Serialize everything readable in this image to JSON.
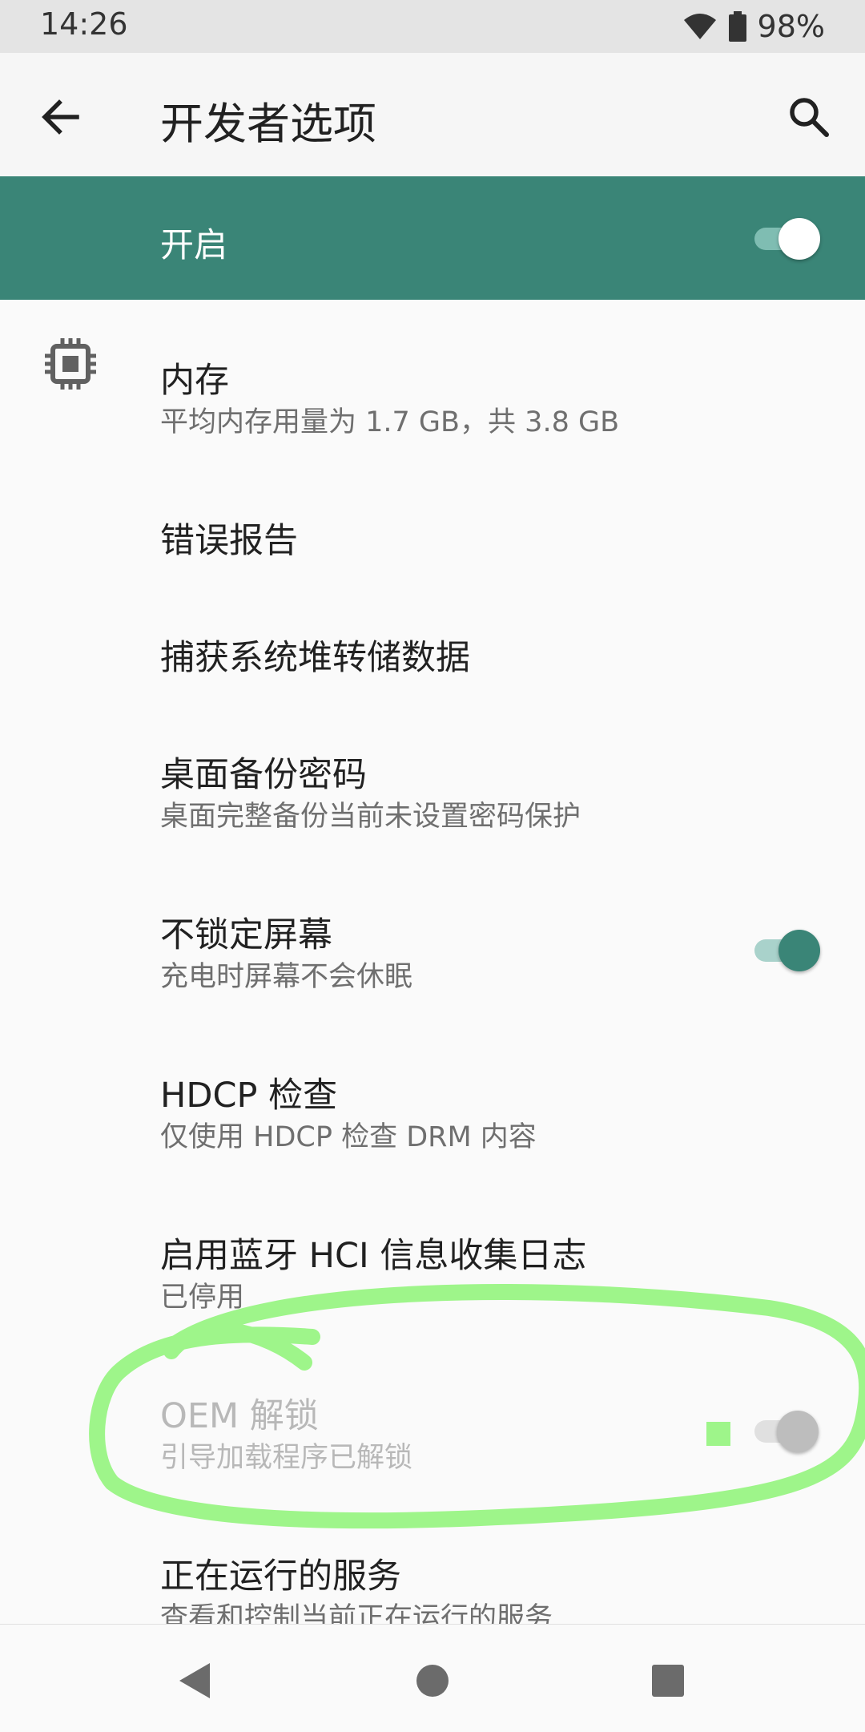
{
  "status_bar": {
    "time": "14:26",
    "battery": "98%"
  },
  "app_bar": {
    "title": "开发者选项"
  },
  "master_switch": {
    "label": "开启",
    "on": true
  },
  "settings": [
    {
      "title": "内存",
      "subtitle": "平均内存用量为 1.7 GB，共 3.8 GB",
      "icon": "memory-chip-icon"
    },
    {
      "title": "错误报告"
    },
    {
      "title": "捕获系统堆转储数据"
    },
    {
      "title": "桌面备份密码",
      "subtitle": "桌面完整备份当前未设置密码保护"
    },
    {
      "title": "不锁定屏幕",
      "subtitle": "充电时屏幕不会休眠",
      "switch_on": true
    },
    {
      "title": "HDCP 检查",
      "subtitle": "仅使用 HDCP 检查 DRM 内容"
    },
    {
      "title": "启用蓝牙 HCI 信息收集日志",
      "subtitle": "已停用"
    },
    {
      "title": "OEM 解锁",
      "subtitle": "引导加载程序已解锁",
      "switch_on": false,
      "disabled": true
    },
    {
      "title": "正在运行的服务",
      "subtitle": "查看和控制当前正在运行的服务"
    }
  ],
  "colors": {
    "accent": "#3a8577",
    "annotation": "#9ef58a"
  },
  "nav_bar": [
    "back-icon",
    "home-icon",
    "recents-icon"
  ]
}
